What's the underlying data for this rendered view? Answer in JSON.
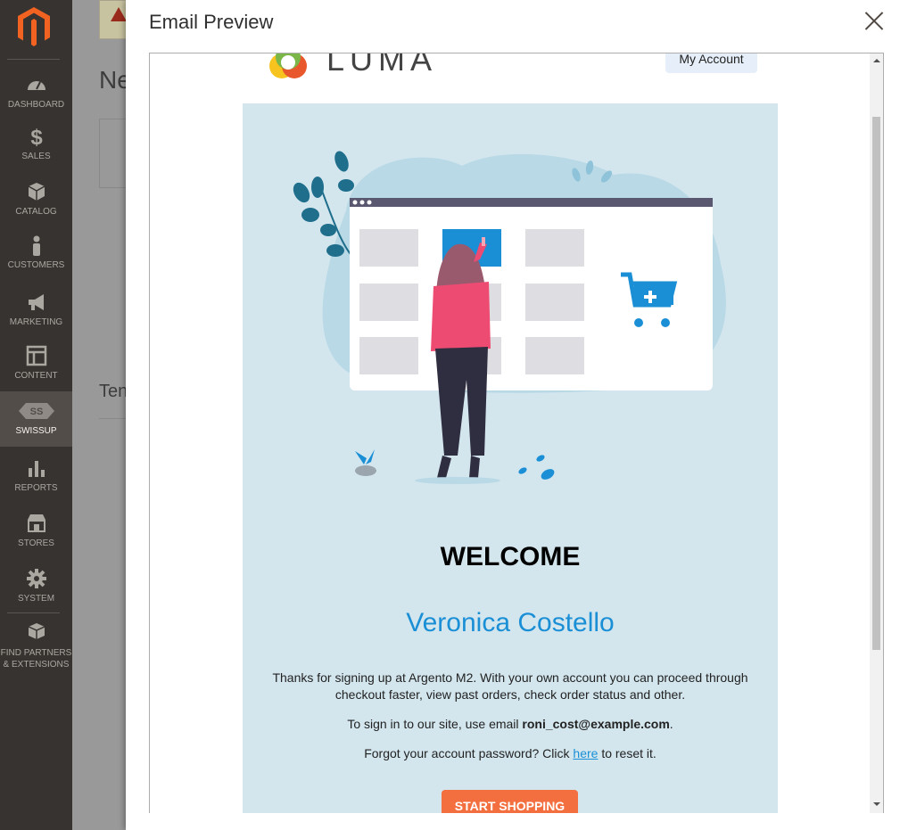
{
  "sidebar": {
    "items": [
      {
        "label": "DASHBOARD",
        "icon": "dashboard-icon"
      },
      {
        "label": "SALES",
        "icon": "dollar-icon"
      },
      {
        "label": "CATALOG",
        "icon": "box-icon"
      },
      {
        "label": "CUSTOMERS",
        "icon": "person-icon"
      },
      {
        "label": "MARKETING",
        "icon": "megaphone-icon"
      },
      {
        "label": "CONTENT",
        "icon": "layout-icon"
      },
      {
        "label": "SWISSUP",
        "icon": "swissup-icon"
      },
      {
        "label": "REPORTS",
        "icon": "bar-chart-icon"
      },
      {
        "label": "STORES",
        "icon": "store-icon"
      },
      {
        "label": "SYSTEM",
        "icon": "gear-icon"
      },
      {
        "label1": "FIND PARTNERS",
        "label2": "& EXTENSIONS",
        "icon": "cubes-icon"
      }
    ],
    "active": "SWISSUP"
  },
  "background": {
    "title_fragment": "Ne",
    "section_fragment": "Ten"
  },
  "modal": {
    "title": "Email Preview"
  },
  "email": {
    "logo_text": "LUMA",
    "account_button": "My Account",
    "welcome": "WELCOME",
    "customer_name": "Veronica Costello",
    "intro": "Thanks for signing up at Argento M2. With your own account you can proceed through checkout faster, view past orders, check order status and other.",
    "signin_prefix": "To sign in to our site, use email ",
    "signin_email": "roni_cost@example.com",
    "signin_suffix": ".",
    "forgot_prefix": "Forgot your account password? Click ",
    "forgot_link": "here",
    "forgot_suffix": " to reset it.",
    "cta": "START SHOPPING"
  },
  "colors": {
    "sidebar_bg": "#373330",
    "email_body_bg": "#d3e6ee",
    "accent_blue": "#1a8fd6",
    "cta_orange": "#f36f3f"
  }
}
